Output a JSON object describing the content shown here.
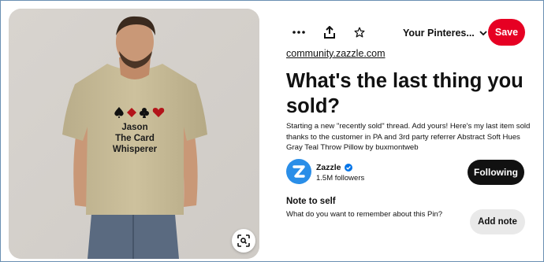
{
  "image": {
    "shirt_print": {
      "line1": "Jason",
      "line2": "The Card",
      "line3": "Whisperer"
    }
  },
  "toolbar": {
    "more_icon": "more-dots-icon",
    "share_icon": "share-upload-icon",
    "bookmark_icon": "bookmark-icon",
    "board_label": "Your Pinteres...",
    "save_label": "Save"
  },
  "pin": {
    "source": "community.zazzle.com",
    "title": "What's the last thing you sold?",
    "description": "Starting a new \"recently sold\" thread. Add yours! Here's my last item sold thanks to the customer in PA and 3rd party referrer Abstract Soft Hues Gray Teal Throw Pillow by buxmontweb"
  },
  "creator": {
    "name": "Zazzle",
    "followers": "1.5M followers",
    "follow_label": "Following",
    "verified_icon": "verified-check-icon"
  },
  "note": {
    "heading": "Note to self",
    "prompt": "What do you want to remember about this Pin?",
    "button_label": "Add note"
  },
  "colors": {
    "save": "#e60023",
    "following": "#111111",
    "avatar": "#2a8ee8",
    "verified": "#0074e8"
  }
}
